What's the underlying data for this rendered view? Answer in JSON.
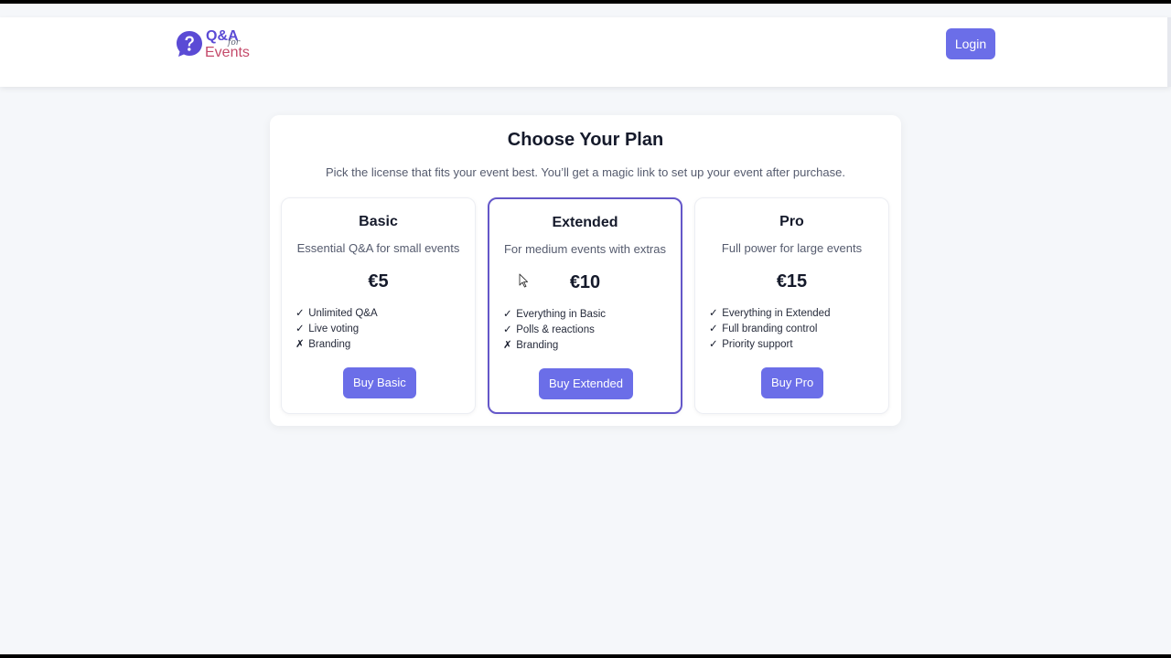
{
  "header": {
    "logo": {
      "qa": "Q&A",
      "for": "for",
      "events": "Events"
    },
    "login_label": "Login"
  },
  "main": {
    "title": "Choose Your Plan",
    "subtitle": "Pick the license that fits your event best. You’ll get a magic link to set up your event after purchase."
  },
  "plans": [
    {
      "name": "Basic",
      "description": "Essential Q&A for small events",
      "price": "€5",
      "features": [
        {
          "mark": "✓",
          "text": "Unlimited Q&A"
        },
        {
          "mark": "✓",
          "text": "Live voting"
        },
        {
          "mark": "✗",
          "text": "Branding"
        }
      ],
      "button": "Buy Basic"
    },
    {
      "name": "Extended",
      "description": "For medium events with extras",
      "price": "€10",
      "features": [
        {
          "mark": "✓",
          "text": "Everything in Basic"
        },
        {
          "mark": "✓",
          "text": "Polls & reactions"
        },
        {
          "mark": "✗",
          "text": "Branding"
        }
      ],
      "button": "Buy Extended"
    },
    {
      "name": "Pro",
      "description": "Full power for large events",
      "price": "€15",
      "features": [
        {
          "mark": "✓",
          "text": "Everything in Extended"
        },
        {
          "mark": "✓",
          "text": "Full branding control"
        },
        {
          "mark": "✓",
          "text": "Priority support"
        }
      ],
      "button": "Buy Pro"
    }
  ],
  "colors": {
    "accent": "#6b6ee8",
    "featured_border": "#6457c9",
    "logo_primary": "#5b4bd5",
    "logo_secondary": "#c44a6a",
    "background": "#f5f7fa"
  },
  "icons": {
    "logo": "speech-bubble-question-icon",
    "cursor": "mouse-pointer-icon"
  }
}
